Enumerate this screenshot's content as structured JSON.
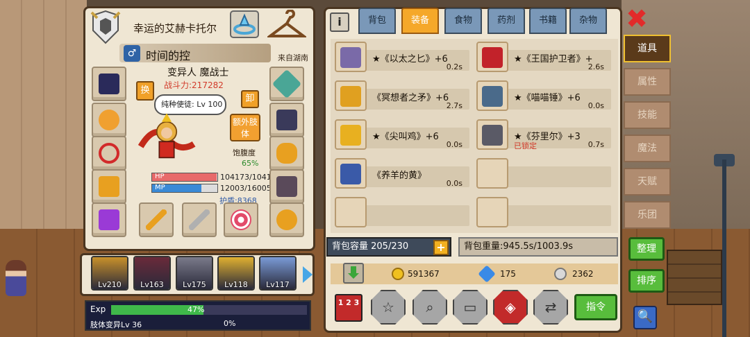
{
  "character": {
    "title": "幸运的艾赫卡托尔",
    "gender_symbol": "♂",
    "name": "时间的控",
    "origin": "来自湖南",
    "class": "变异人 魔战士",
    "power": "战斗力:217282",
    "swap_label": "换",
    "unload_label": "卸",
    "speech": "纯种使徒: Lv 100",
    "extra_limb_label": "额外肢体",
    "satiety_label": "饱腹度",
    "satiety_value": "65%",
    "hp_label": "HP",
    "hp_value": "104173/10417",
    "hp_fraction": 0.99,
    "mp_label": "MP",
    "mp_value": "12003/16005",
    "mp_fraction": 0.75,
    "armor": "护盾:8368"
  },
  "party": [
    {
      "level": "Lv210",
      "color": "#c8902a"
    },
    {
      "level": "Lv163",
      "color": "#6a2a3a"
    },
    {
      "level": "Lv175",
      "color": "#7a7a8a"
    },
    {
      "level": "Lv118",
      "color": "#e0b030"
    },
    {
      "level": "Lv117",
      "color": "#7a9ad6"
    }
  ],
  "exp": {
    "label": "Exp",
    "percent_text": "47%",
    "fraction": 0.47,
    "limb_label": "肢体变异Lv 36",
    "limb_percent": "0%"
  },
  "inventory": {
    "info_label": "i",
    "tabs": [
      "背包",
      "装备",
      "食物",
      "药剂",
      "书籍",
      "杂物"
    ],
    "active_tab": "装备",
    "items": [
      {
        "name": "★《以太之匕》+6",
        "weight": "0.2s",
        "lock": "",
        "color": "#7a6aa8"
      },
      {
        "name": "★《王国护卫者》+",
        "weight": "2.6s",
        "lock": "",
        "color": "#c2222a"
      },
      {
        "name": "《冥想者之矛》+6",
        "weight": "2.7s",
        "lock": "",
        "color": "#e0a020"
      },
      {
        "name": "★《喵喵锤》+6",
        "weight": "0.0s",
        "lock": "",
        "color": "#4a6a8a"
      },
      {
        "name": "★《尖叫鸡》+6",
        "weight": "0.0s",
        "lock": "",
        "color": "#e8b020"
      },
      {
        "name": "★《芬里尔》+3",
        "weight": "0.7s",
        "lock": "已锁定",
        "color": "#5a5a66"
      },
      {
        "name": "《养羊的黄》",
        "weight": "0.0s",
        "lock": "",
        "color": "#3a5aa8"
      }
    ],
    "capacity": "背包容量 205/230",
    "plus_label": "+",
    "weight": "背包重量:945.5s/1003.9s",
    "gold": "591367",
    "diamonds": "175",
    "silver": "2362",
    "rank_label": "1 2 3",
    "command_label": "指令"
  },
  "side_menu": {
    "close_label": "✖",
    "tabs": [
      "道具",
      "属性",
      "技能",
      "魔法",
      "天赋",
      "乐团"
    ],
    "active_tab": "道具",
    "organize_label": "整理",
    "sort_label": "排序",
    "search_symbol": "🔍"
  }
}
